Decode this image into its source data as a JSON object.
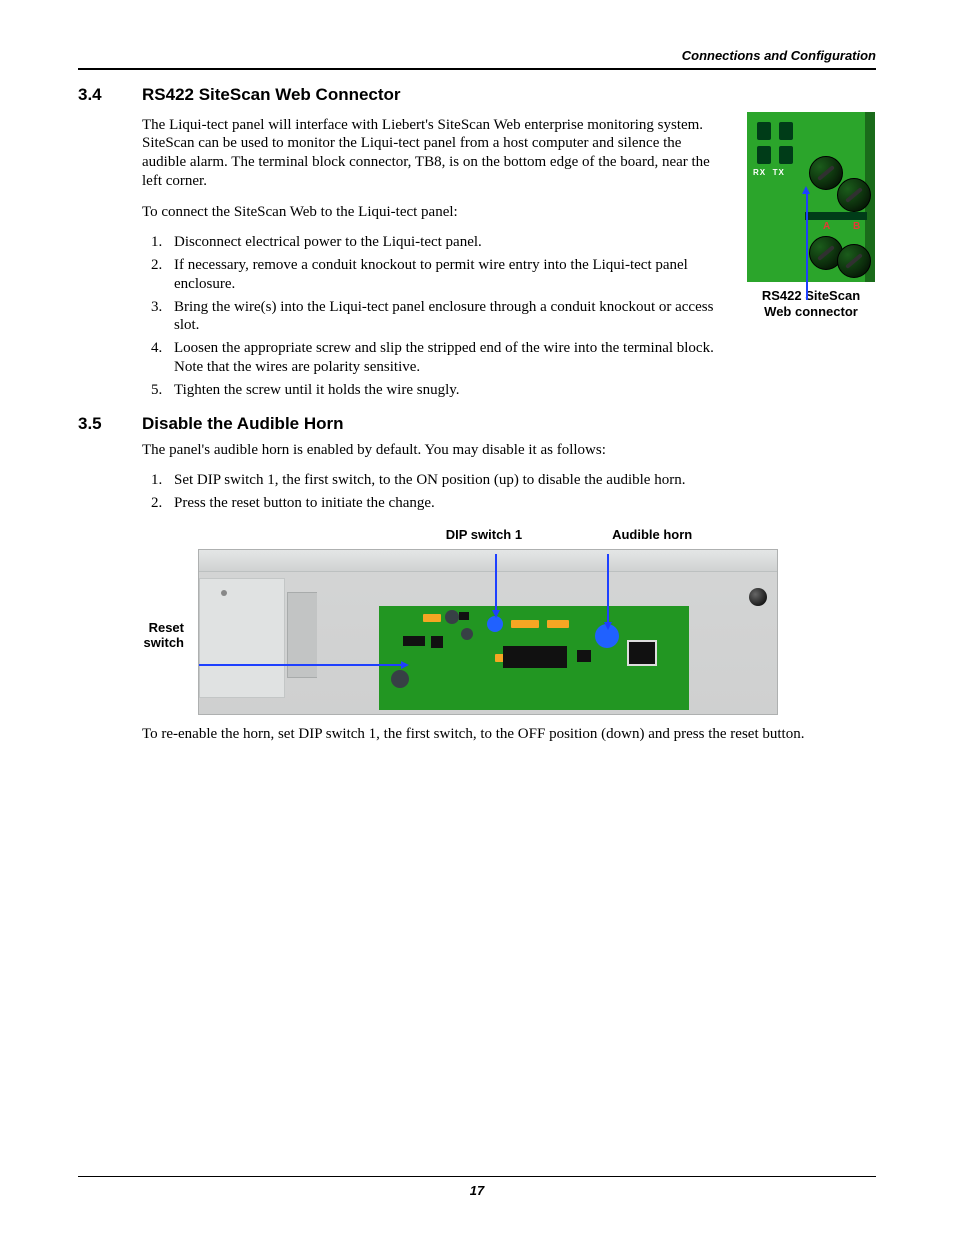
{
  "header": {
    "running_head": "Connections and Configuration"
  },
  "section34": {
    "num": "3.4",
    "title": "RS422 SiteScan Web Connector",
    "p1": "The Liqui-tect panel will interface with Liebert's SiteScan Web enterprise monitoring system. SiteScan can be used to monitor the Liqui-tect panel from a host computer and silence the audible alarm. The terminal block connector, TB8, is on the bottom edge of the board, near the left corner.",
    "p2": "To connect the SiteScan Web to the Liqui-tect panel:",
    "steps": [
      "Disconnect electrical power to the Liqui-tect panel.",
      "If necessary, remove a conduit knockout to permit wire entry into the Liqui-tect panel enclosure.",
      "Bring the wire(s) into the Liqui-tect panel enclosure through a conduit knockout or access slot.",
      "Loosen the appropriate screw and slip the stripped end of the wire into the terminal block. Note that the wires are polarity sensitive.",
      "Tighten the screw until it holds the wire snugly."
    ],
    "figure": {
      "rx_label": "RX",
      "tx_label": "TX",
      "a_label": "A",
      "b_label": "B",
      "caption_line1": "RS422 SiteScan",
      "caption_line2": "Web connector"
    }
  },
  "section35": {
    "num": "3.5",
    "title": "Disable the Audible Horn",
    "p1": "The panel's audible horn is enabled by default. You may disable it as follows:",
    "steps": [
      "Set DIP switch 1, the first switch, to the ON position (up) to disable the audible horn.",
      "Press the reset button to initiate the change."
    ],
    "diagram": {
      "dip_label": "DIP switch 1",
      "horn_label": "Audible horn",
      "reset_label_line1": "Reset",
      "reset_label_line2": "switch"
    },
    "p_after": "To re-enable the horn, set DIP switch 1, the first switch, to the OFF position (down) and press the reset button."
  },
  "footer": {
    "page_number": "17"
  }
}
